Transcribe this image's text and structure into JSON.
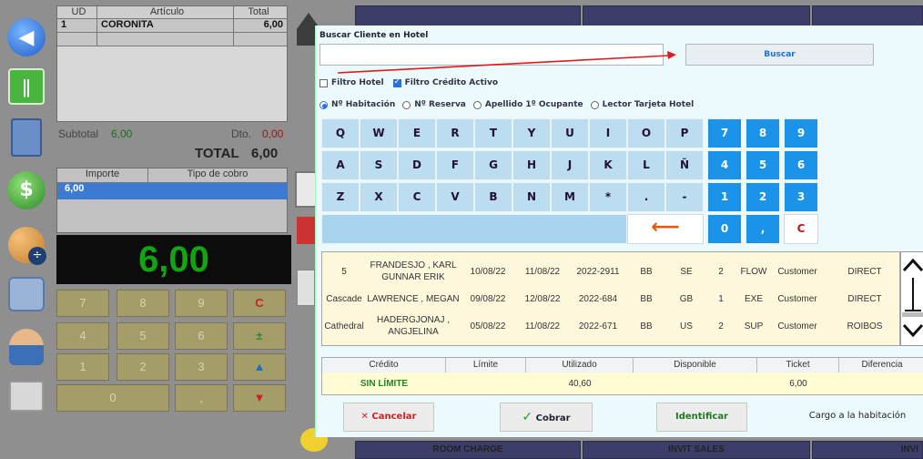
{
  "background": {
    "ticket": {
      "headers": [
        "UD",
        "Artículo",
        "Total"
      ],
      "rows": [
        {
          "ud": "1",
          "articulo": "CORONITA",
          "total": "6,00"
        }
      ]
    },
    "subtotal_label": "Subtotal",
    "subtotal_value": "6,00",
    "dto_label": "Dto.",
    "dto_value": "0,00",
    "total_label": "TOTAL",
    "total_value": "6,00",
    "payments": {
      "headers": [
        "Importe",
        "Tipo de cobro"
      ],
      "rows": [
        {
          "importe": "6,00",
          "tipo": ""
        }
      ]
    },
    "big_total": "6,00",
    "numpad": [
      "7",
      "8",
      "9",
      "C",
      "4",
      "5",
      "6",
      "",
      "1",
      "2",
      "3",
      "",
      "0",
      ","
    ],
    "bottom_tabs": [
      "ROOM CHARGE",
      "INVIT SALES",
      "INVI"
    ]
  },
  "dialog": {
    "title": "Buscar Cliente en Hotel",
    "search_value": "",
    "search_button": "Buscar",
    "filters": [
      {
        "label": "Filtro Hotel",
        "checked": false
      },
      {
        "label": "Filtro Crédito Activo",
        "checked": true
      }
    ],
    "search_modes": [
      {
        "label": "Nº Habitación",
        "selected": true
      },
      {
        "label": "Nº Reserva",
        "selected": false
      },
      {
        "label": "Apellido 1º Ocupante",
        "selected": false
      },
      {
        "label": "Lector Tarjeta Hotel",
        "selected": false
      }
    ],
    "keyboard": {
      "row1": [
        "Q",
        "W",
        "E",
        "R",
        "T",
        "Y",
        "U",
        "I",
        "O",
        "P",
        "7",
        "8",
        "9"
      ],
      "row2": [
        "A",
        "S",
        "D",
        "F",
        "G",
        "H",
        "J",
        "K",
        "L",
        "Ñ",
        "4",
        "5",
        "6"
      ],
      "row3": [
        "Z",
        "X",
        "C",
        "V",
        "B",
        "N",
        "M",
        "*",
        ".",
        "-",
        "1",
        "2",
        "3"
      ],
      "row4": [
        "0",
        ",",
        "C"
      ]
    },
    "results": [
      [
        "5",
        "FRANDESJO , KARL GUNNAR ERIK",
        "10/08/22",
        "11/08/22",
        "2022-2911",
        "BB",
        "SE",
        "2",
        "FLOW",
        "Customer",
        "DIRECT"
      ],
      [
        "Cascade",
        "LAWRENCE , MEGAN",
        "09/08/22",
        "12/08/22",
        "2022-684",
        "BB",
        "GB",
        "1",
        "EXE",
        "Customer",
        "DIRECT"
      ],
      [
        "Cathedral",
        "HADERGJONAJ , ANGJELINA",
        "05/08/22",
        "11/08/22",
        "2022-671",
        "BB",
        "US",
        "2",
        "SUP",
        "Customer",
        "ROIBOS"
      ]
    ],
    "credit": {
      "headers": [
        "Crédito",
        "Límite",
        "Utilizado",
        "Disponible",
        "Ticket",
        "Diferencia"
      ],
      "values": [
        "SIN LÍMITE",
        "",
        "40,60",
        "",
        "6,00",
        ""
      ]
    },
    "buttons": {
      "cancel": "Cancelar",
      "charge": "Cobrar",
      "identify": "Identificar",
      "room_charge": "Cargo a la habitación"
    }
  },
  "colors": {
    "accent": "#1b93e8",
    "dialog_bg": "#ecfafd",
    "key_bg": "#bcdcf0",
    "results_bg": "#fdf8dc",
    "total_green": "#11a611",
    "arrow_red": "#e01b1b"
  }
}
